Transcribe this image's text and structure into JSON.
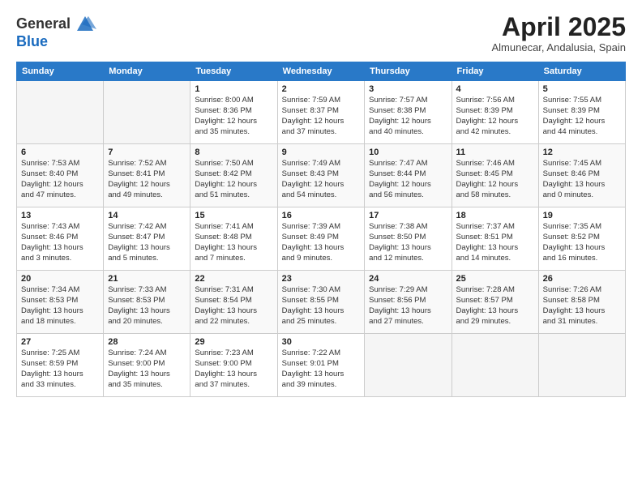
{
  "header": {
    "logo_line1": "General",
    "logo_line2": "Blue",
    "title": "April 2025",
    "location": "Almunecar, Andalusia, Spain"
  },
  "calendar": {
    "days_of_week": [
      "Sunday",
      "Monday",
      "Tuesday",
      "Wednesday",
      "Thursday",
      "Friday",
      "Saturday"
    ],
    "weeks": [
      [
        {
          "day": "",
          "info": ""
        },
        {
          "day": "",
          "info": ""
        },
        {
          "day": "1",
          "info": "Sunrise: 8:00 AM\nSunset: 8:36 PM\nDaylight: 12 hours\nand 35 minutes."
        },
        {
          "day": "2",
          "info": "Sunrise: 7:59 AM\nSunset: 8:37 PM\nDaylight: 12 hours\nand 37 minutes."
        },
        {
          "day": "3",
          "info": "Sunrise: 7:57 AM\nSunset: 8:38 PM\nDaylight: 12 hours\nand 40 minutes."
        },
        {
          "day": "4",
          "info": "Sunrise: 7:56 AM\nSunset: 8:39 PM\nDaylight: 12 hours\nand 42 minutes."
        },
        {
          "day": "5",
          "info": "Sunrise: 7:55 AM\nSunset: 8:39 PM\nDaylight: 12 hours\nand 44 minutes."
        }
      ],
      [
        {
          "day": "6",
          "info": "Sunrise: 7:53 AM\nSunset: 8:40 PM\nDaylight: 12 hours\nand 47 minutes."
        },
        {
          "day": "7",
          "info": "Sunrise: 7:52 AM\nSunset: 8:41 PM\nDaylight: 12 hours\nand 49 minutes."
        },
        {
          "day": "8",
          "info": "Sunrise: 7:50 AM\nSunset: 8:42 PM\nDaylight: 12 hours\nand 51 minutes."
        },
        {
          "day": "9",
          "info": "Sunrise: 7:49 AM\nSunset: 8:43 PM\nDaylight: 12 hours\nand 54 minutes."
        },
        {
          "day": "10",
          "info": "Sunrise: 7:47 AM\nSunset: 8:44 PM\nDaylight: 12 hours\nand 56 minutes."
        },
        {
          "day": "11",
          "info": "Sunrise: 7:46 AM\nSunset: 8:45 PM\nDaylight: 12 hours\nand 58 minutes."
        },
        {
          "day": "12",
          "info": "Sunrise: 7:45 AM\nSunset: 8:46 PM\nDaylight: 13 hours\nand 0 minutes."
        }
      ],
      [
        {
          "day": "13",
          "info": "Sunrise: 7:43 AM\nSunset: 8:46 PM\nDaylight: 13 hours\nand 3 minutes."
        },
        {
          "day": "14",
          "info": "Sunrise: 7:42 AM\nSunset: 8:47 PM\nDaylight: 13 hours\nand 5 minutes."
        },
        {
          "day": "15",
          "info": "Sunrise: 7:41 AM\nSunset: 8:48 PM\nDaylight: 13 hours\nand 7 minutes."
        },
        {
          "day": "16",
          "info": "Sunrise: 7:39 AM\nSunset: 8:49 PM\nDaylight: 13 hours\nand 9 minutes."
        },
        {
          "day": "17",
          "info": "Sunrise: 7:38 AM\nSunset: 8:50 PM\nDaylight: 13 hours\nand 12 minutes."
        },
        {
          "day": "18",
          "info": "Sunrise: 7:37 AM\nSunset: 8:51 PM\nDaylight: 13 hours\nand 14 minutes."
        },
        {
          "day": "19",
          "info": "Sunrise: 7:35 AM\nSunset: 8:52 PM\nDaylight: 13 hours\nand 16 minutes."
        }
      ],
      [
        {
          "day": "20",
          "info": "Sunrise: 7:34 AM\nSunset: 8:53 PM\nDaylight: 13 hours\nand 18 minutes."
        },
        {
          "day": "21",
          "info": "Sunrise: 7:33 AM\nSunset: 8:53 PM\nDaylight: 13 hours\nand 20 minutes."
        },
        {
          "day": "22",
          "info": "Sunrise: 7:31 AM\nSunset: 8:54 PM\nDaylight: 13 hours\nand 22 minutes."
        },
        {
          "day": "23",
          "info": "Sunrise: 7:30 AM\nSunset: 8:55 PM\nDaylight: 13 hours\nand 25 minutes."
        },
        {
          "day": "24",
          "info": "Sunrise: 7:29 AM\nSunset: 8:56 PM\nDaylight: 13 hours\nand 27 minutes."
        },
        {
          "day": "25",
          "info": "Sunrise: 7:28 AM\nSunset: 8:57 PM\nDaylight: 13 hours\nand 29 minutes."
        },
        {
          "day": "26",
          "info": "Sunrise: 7:26 AM\nSunset: 8:58 PM\nDaylight: 13 hours\nand 31 minutes."
        }
      ],
      [
        {
          "day": "27",
          "info": "Sunrise: 7:25 AM\nSunset: 8:59 PM\nDaylight: 13 hours\nand 33 minutes."
        },
        {
          "day": "28",
          "info": "Sunrise: 7:24 AM\nSunset: 9:00 PM\nDaylight: 13 hours\nand 35 minutes."
        },
        {
          "day": "29",
          "info": "Sunrise: 7:23 AM\nSunset: 9:00 PM\nDaylight: 13 hours\nand 37 minutes."
        },
        {
          "day": "30",
          "info": "Sunrise: 7:22 AM\nSunset: 9:01 PM\nDaylight: 13 hours\nand 39 minutes."
        },
        {
          "day": "",
          "info": ""
        },
        {
          "day": "",
          "info": ""
        },
        {
          "day": "",
          "info": ""
        }
      ]
    ]
  }
}
